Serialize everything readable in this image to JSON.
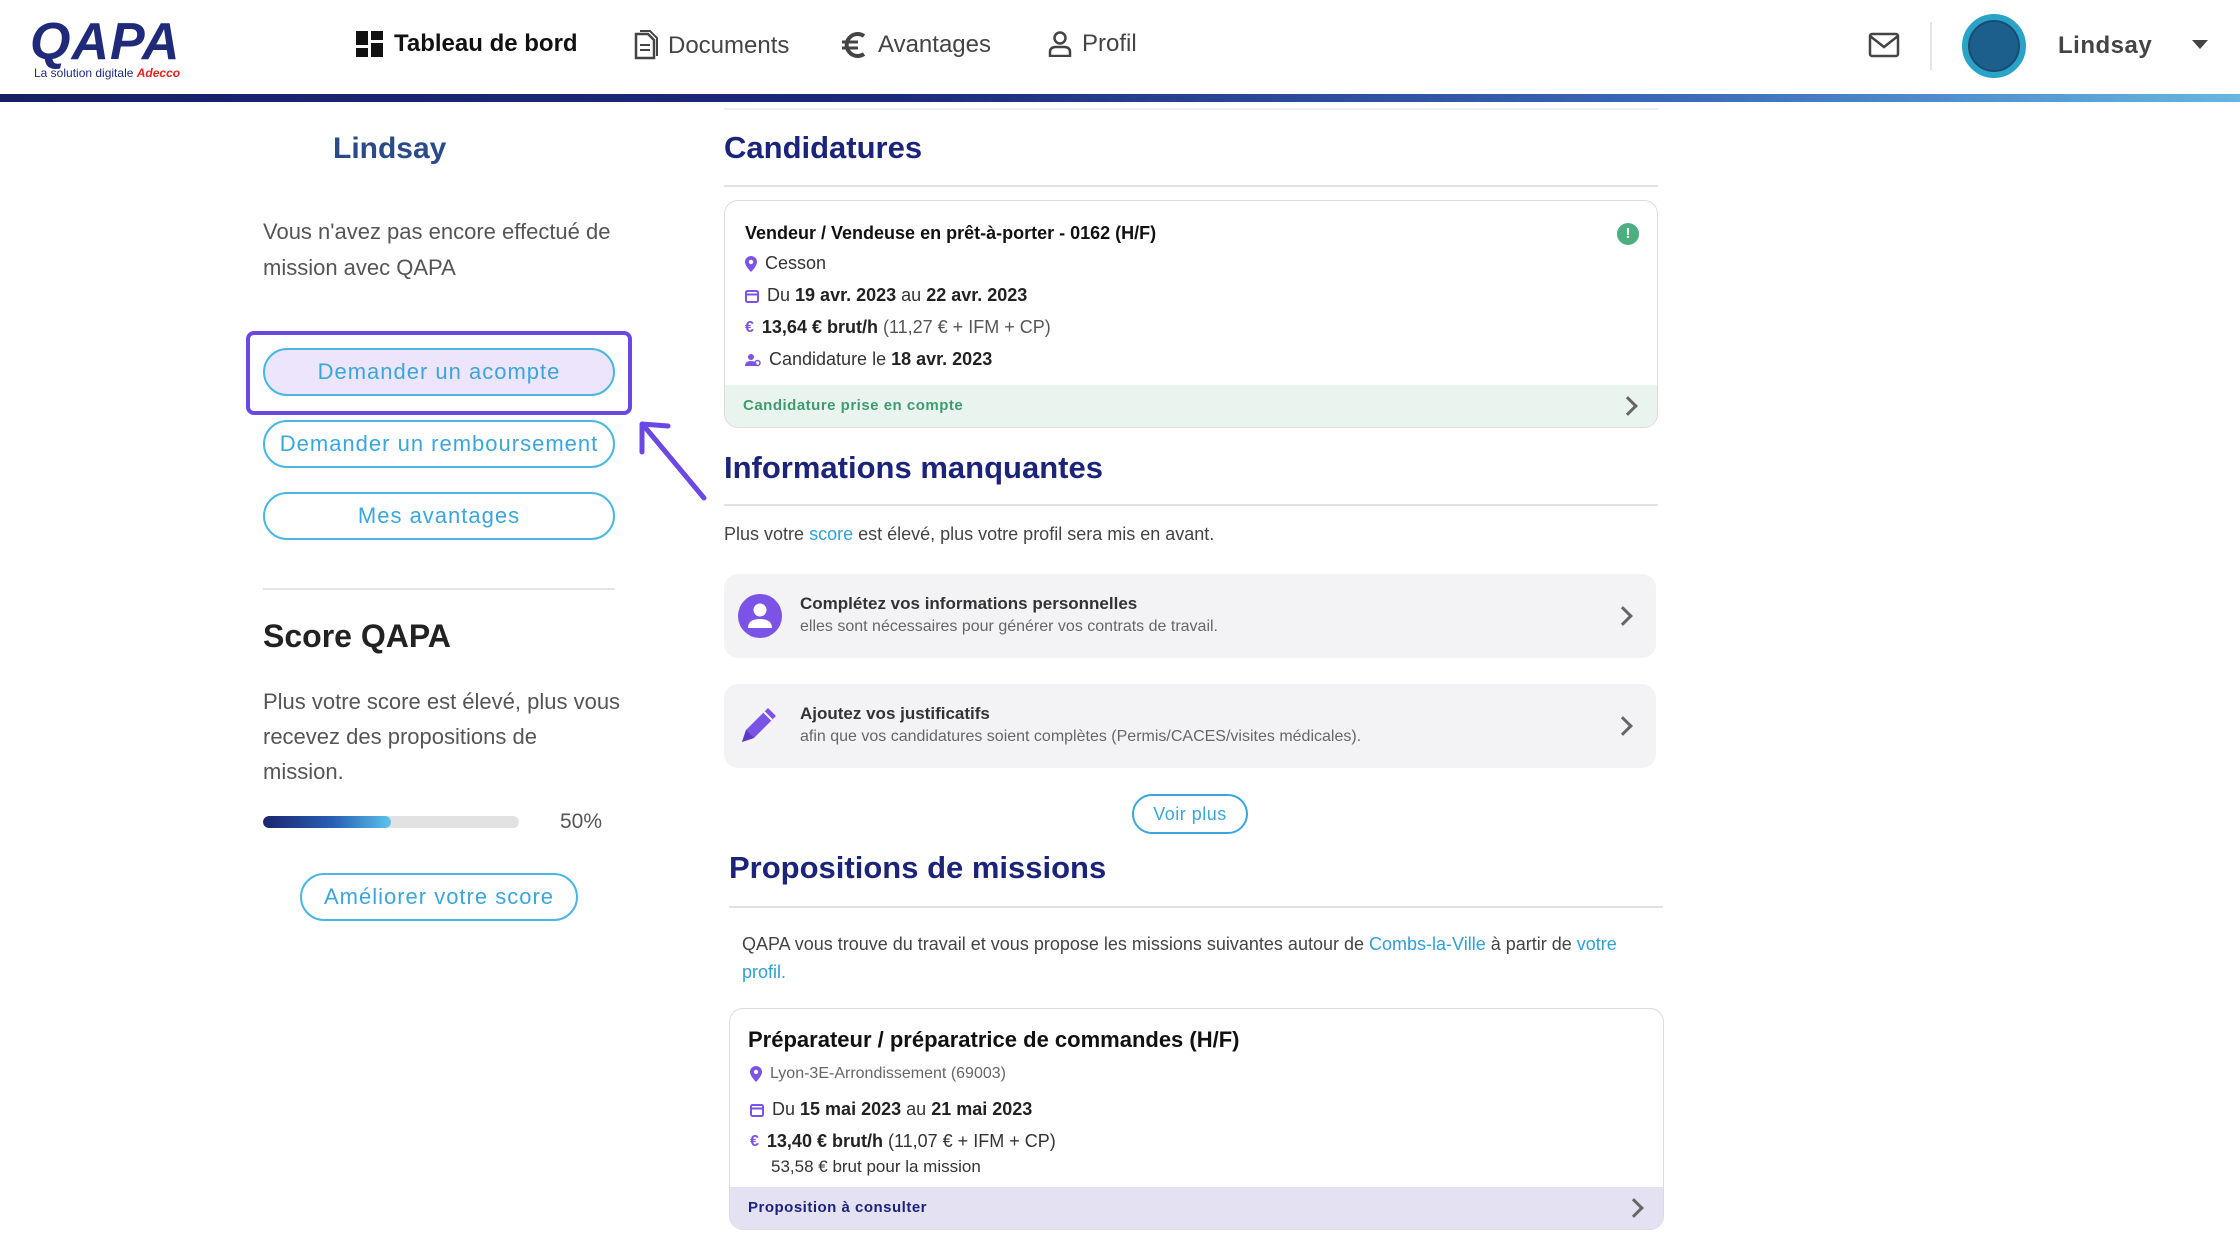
{
  "header": {
    "logo_text": "QAPA",
    "logo_tagline": "La solution digitale",
    "logo_brand": "Adecco",
    "nav": [
      {
        "label": "Tableau de bord",
        "icon": "dashboard-icon",
        "active": true
      },
      {
        "label": "Documents",
        "icon": "document-icon",
        "active": false
      },
      {
        "label": "Avantages",
        "icon": "euro-icon",
        "active": false
      },
      {
        "label": "Profil",
        "icon": "user-icon",
        "active": false
      }
    ],
    "user_name": "Lindsay"
  },
  "sidebar": {
    "name": "Lindsay",
    "no_mission_text": "Vous n'avez pas encore effectué de mission avec QAPA",
    "buttons": {
      "advance": "Demander un acompte",
      "refund": "Demander un remboursement",
      "benefits": "Mes avantages"
    },
    "score": {
      "title": "Score QAPA",
      "text": "Plus votre score est élevé, plus vous recevez des propositions de mission.",
      "percent": 50,
      "percent_label": "50%",
      "improve_label": "Améliorer votre score"
    }
  },
  "candidatures": {
    "title": "Candidatures",
    "card": {
      "job_title": "Vendeur / Vendeuse en prêt-à-porter - 0162 (H/F)",
      "location": "Cesson",
      "date_prefix": "Du",
      "date_start": "19 avr. 2023",
      "date_mid": "au",
      "date_end": "22 avr. 2023",
      "pay": "13,64 € brut/h",
      "pay_detail": "(11,27 € + IFM + CP)",
      "applied_prefix": "Candidature le",
      "applied_date": "18 avr. 2023",
      "status": "Candidature prise en compte"
    }
  },
  "missing_info": {
    "title": "Informations manquantes",
    "intro_before": "Plus votre",
    "intro_link": "score",
    "intro_after": "est élevé, plus votre profil sera mis en avant.",
    "items": [
      {
        "title": "Complétez vos informations personnelles",
        "subtitle": "elles sont nécessaires pour générer vos contrats de travail.",
        "icon": "person-circle-icon"
      },
      {
        "title": "Ajoutez vos justificatifs",
        "subtitle": "afin que vos candidatures soient complètes (Permis/CACES/visites médicales).",
        "icon": "pencil-icon"
      }
    ],
    "see_more": "Voir plus"
  },
  "missions": {
    "title": "Propositions de missions",
    "intro_before": "QAPA vous trouve du travail et vous propose les missions suivantes autour de",
    "intro_city": "Combs-la-Ville",
    "intro_after": "à partir de",
    "intro_link": "votre profil.",
    "card": {
      "job_title": "Préparateur / préparatrice de commandes (H/F)",
      "location": "Lyon-3E-Arrondissement (69003)",
      "date_prefix": "Du",
      "date_start": "15 mai 2023",
      "date_mid": "au",
      "date_end": "21 mai 2023",
      "pay": "13,40 € brut/h",
      "pay_detail": "(11,07 € + IFM + CP)",
      "total": "53,58 € brut pour la mission",
      "status": "Proposition à consulter"
    }
  },
  "colors": {
    "navy": "#1b237a",
    "accent_blue": "#3aa6dd",
    "highlight_purple": "#6a48e6",
    "success_green": "#4caf80",
    "icon_purple": "#7b53e6"
  }
}
